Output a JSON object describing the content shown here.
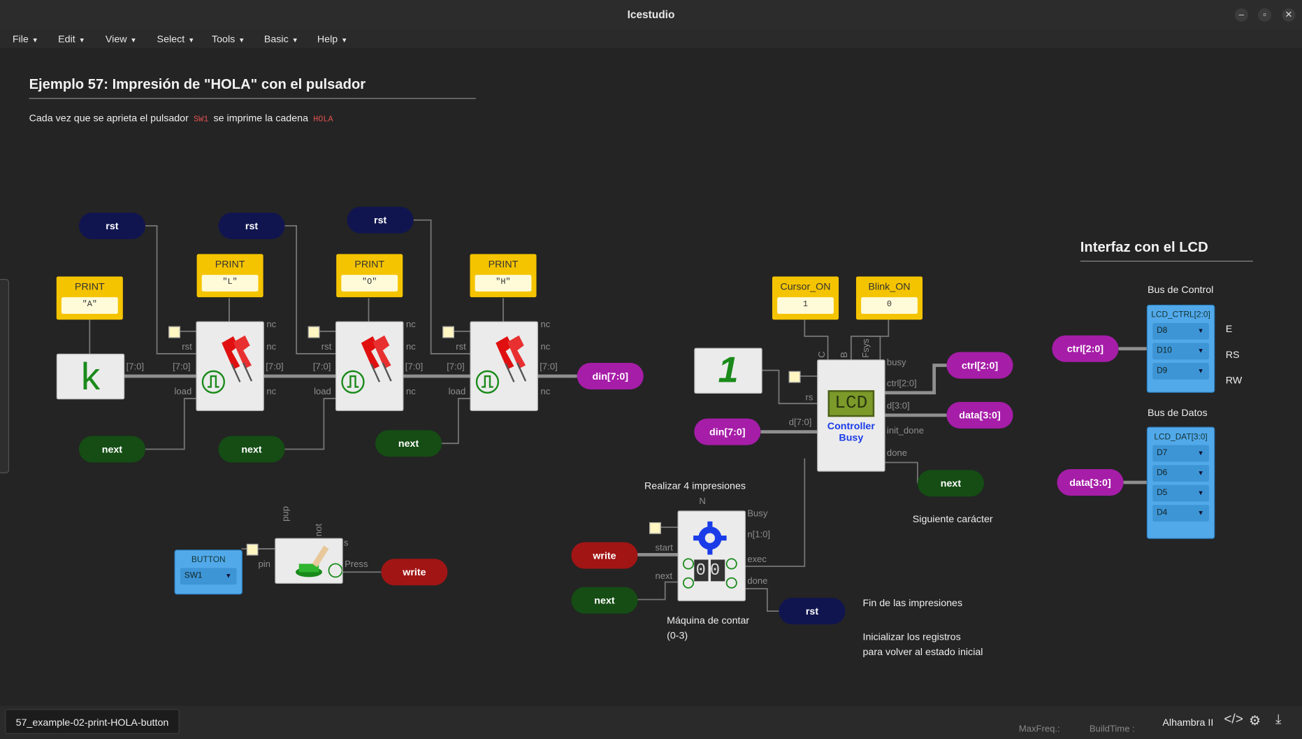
{
  "window": {
    "title": "Icestudio"
  },
  "menu": [
    "File",
    "Edit",
    "View",
    "Select",
    "Tools",
    "Basic",
    "Help"
  ],
  "heading": {
    "title": "Ejemplo 57: Impresión de \"HOLA\" con el pulsador"
  },
  "description": {
    "before": "Cada vez que se aprieta el pulsador",
    "code1": "SW1",
    "middle": "se imprime la cadena",
    "code2": "HOLA"
  },
  "labels": {
    "rst": "rst",
    "next": "next",
    "din": "din[7:0]",
    "write": "write",
    "ctrl": "ctrl[2:0]",
    "data": "data[3:0]"
  },
  "print": {
    "name": "PRINT",
    "values": [
      "\"A\"",
      "\"L\"",
      "\"O\"",
      "\"H\""
    ]
  },
  "k_block": {
    "text": "k"
  },
  "ports": {
    "nc": "nc",
    "rst": "rst",
    "load": "load",
    "bus": "[7:0]",
    "pup": "pup",
    "not": "not",
    "pin": "pin",
    "press": "Press",
    "s": "s",
    "busy": "busy",
    "ctrl": "ctrl[2:0]",
    "d30": "d[3:0]",
    "init_done": "init_done",
    "done": "done",
    "d70": "d[7:0]",
    "rs": "rs",
    "C": "C",
    "B": "B",
    "Fsys": "Fsys",
    "N": "N",
    "Busy": "Busy",
    "n10": "n[1:0]",
    "exec": "exec",
    "start": "start",
    "cnext": "next",
    "cdone": "done"
  },
  "cursor_const": {
    "name": "Cursor_ON",
    "value": "1"
  },
  "blink_const": {
    "name": "Blink_ON",
    "value": "0"
  },
  "lcd": {
    "screen": "LCD",
    "name1": "Controller",
    "name2": "Busy"
  },
  "one_block": {
    "text": "1"
  },
  "counter": {
    "digits": "00"
  },
  "button": {
    "title": "BUTTON",
    "value": "SW1"
  },
  "lcd_ctrl": {
    "title": "LCD_CTRL[2:0]",
    "pins": [
      "D8",
      "D10",
      "D9"
    ],
    "signals": [
      "E",
      "RS",
      "RW"
    ]
  },
  "lcd_dat": {
    "title": "LCD_DAT[3:0]",
    "pins": [
      "D7",
      "D6",
      "D5",
      "D4"
    ]
  },
  "notes": {
    "realizar": "Realizar 4 impresiones",
    "maquina1": "Máquina de contar",
    "maquina2": "(0-3)",
    "siguiente": "Siguiente carácter",
    "fin": "Fin de las impresiones",
    "init1": "Inicializar los registros",
    "init2": "para volver al estado inicial"
  },
  "lcd_section": {
    "title": "Interfaz con el LCD",
    "control": "Bus de Control",
    "datos": "Bus de Datos"
  },
  "status": {
    "tab": "57_example-02-print-HOLA-button",
    "maxfreq": "MaxFreq.:",
    "buildtime": "BuildTime :",
    "board": "Alhambra II"
  },
  "colors": {
    "rst": "#11154f",
    "next": "#154d14",
    "din": "#a61da8",
    "write": "#a11515",
    "const": "#f5c400",
    "pin": "#52a9ea"
  }
}
